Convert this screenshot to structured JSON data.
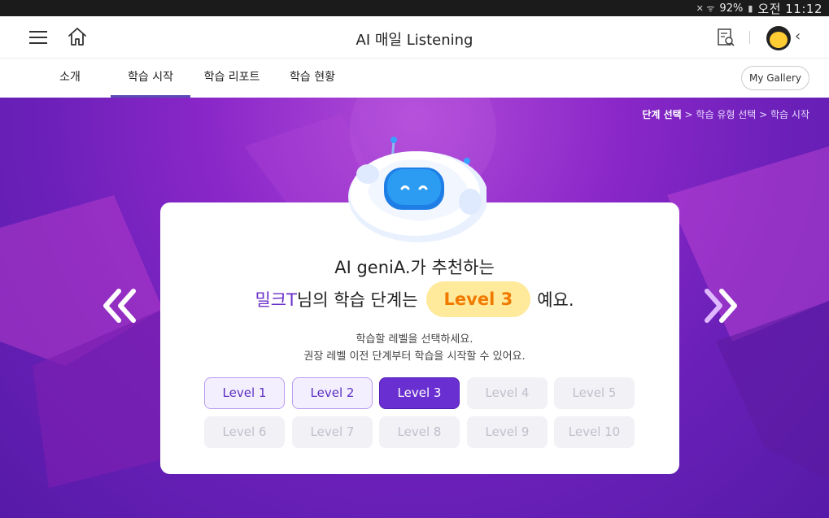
{
  "status_bar": {
    "battery": "92%",
    "time": "오전 11:12"
  },
  "header": {
    "title": "AI 매일 Listening"
  },
  "tabs": [
    {
      "label": "소개"
    },
    {
      "label": "학습 시작"
    },
    {
      "label": "학습 리포트"
    },
    {
      "label": "학습 현황"
    }
  ],
  "gallery_label": "My Gallery",
  "breadcrumb": {
    "current": "단계 선택",
    "step2": "학습 유형 선택",
    "step3": "학습 시작",
    "sep": ">"
  },
  "recommendation": {
    "line1": "AI geniA.가 추천하는",
    "name": "밀크T",
    "middle": " 님의 학습 단계는",
    "level": "Level 3",
    "suffix": "예요.",
    "instruction1": "학습할 레벨을 선택하세요.",
    "instruction2": "권장 레벨 이전 단계부터 학습을 시작할 수 있어요."
  },
  "levels": [
    {
      "label": "Level 1",
      "state": "available"
    },
    {
      "label": "Level 2",
      "state": "available"
    },
    {
      "label": "Level 3",
      "state": "selected"
    },
    {
      "label": "Level 4",
      "state": "disabled"
    },
    {
      "label": "Level 5",
      "state": "disabled"
    },
    {
      "label": "Level 6",
      "state": "disabled"
    },
    {
      "label": "Level 7",
      "state": "disabled"
    },
    {
      "label": "Level 8",
      "state": "disabled"
    },
    {
      "label": "Level 9",
      "state": "disabled"
    },
    {
      "label": "Level 10",
      "state": "disabled"
    }
  ],
  "colors": {
    "accent": "#6a2fd0",
    "highlight": "#f07a00",
    "background": "#8a27c8"
  },
  "icons": [
    "menu-icon",
    "home-icon",
    "report-search-icon",
    "avatar",
    "chevron-left-icon",
    "double-chevron-left-icon",
    "double-chevron-right-icon"
  ]
}
